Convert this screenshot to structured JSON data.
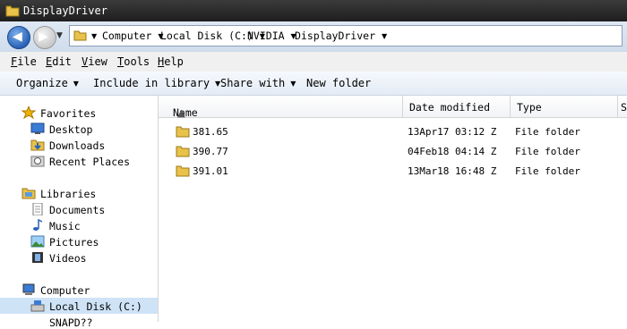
{
  "window": {
    "title": "DisplayDriver"
  },
  "address": {
    "crumbs": [
      "Computer",
      "Local Disk (C:)",
      "NVIDIA",
      "DisplayDriver"
    ]
  },
  "menu": {
    "file": {
      "hot": "F",
      "rest": "ile"
    },
    "edit": {
      "hot": "E",
      "rest": "dit"
    },
    "view": {
      "hot": "V",
      "rest": "iew"
    },
    "tools": {
      "hot": "T",
      "rest": "ools"
    },
    "help": {
      "hot": "H",
      "rest": "elp"
    }
  },
  "toolbar": {
    "organize": "Organize",
    "include": "Include in library",
    "share": "Share with",
    "new_folder": "New folder"
  },
  "nav": {
    "favorites": "Favorites",
    "desktop": "Desktop",
    "downloads": "Downloads",
    "recent": "Recent Places",
    "libraries": "Libraries",
    "documents": "Documents",
    "music": "Music",
    "pictures": "Pictures",
    "videos": "Videos",
    "computer": "Computer",
    "local_disk": "Local Disk (C:)",
    "snapdrive_partial": "SNAPD??"
  },
  "columns": {
    "name": "Name",
    "date": "Date modified",
    "type": "Type",
    "size_partial": "S"
  },
  "files": [
    {
      "name": "381.65",
      "date": "13Apr17 03:12 Z",
      "type": "File folder"
    },
    {
      "name": "390.77",
      "date": "04Feb18 04:14 Z",
      "type": "File folder"
    },
    {
      "name": "391.01",
      "date": "13Mar18 16:48 Z",
      "type": "File folder"
    }
  ],
  "icons": {
    "folder": "folder-icon",
    "favorites": "star-icon",
    "desktop": "desktop-icon",
    "downloads": "downloads-folder-icon",
    "recent": "recent-places-icon",
    "libraries": "libraries-icon",
    "documents": "documents-icon",
    "music": "music-icon",
    "pictures": "pictures-icon",
    "videos": "videos-icon",
    "computer": "computer-icon",
    "disk": "local-disk-icon"
  },
  "colors": {
    "titlebar": "#2a2a2a",
    "selection": "#cfe3f7",
    "folder": "#e8c24a"
  }
}
